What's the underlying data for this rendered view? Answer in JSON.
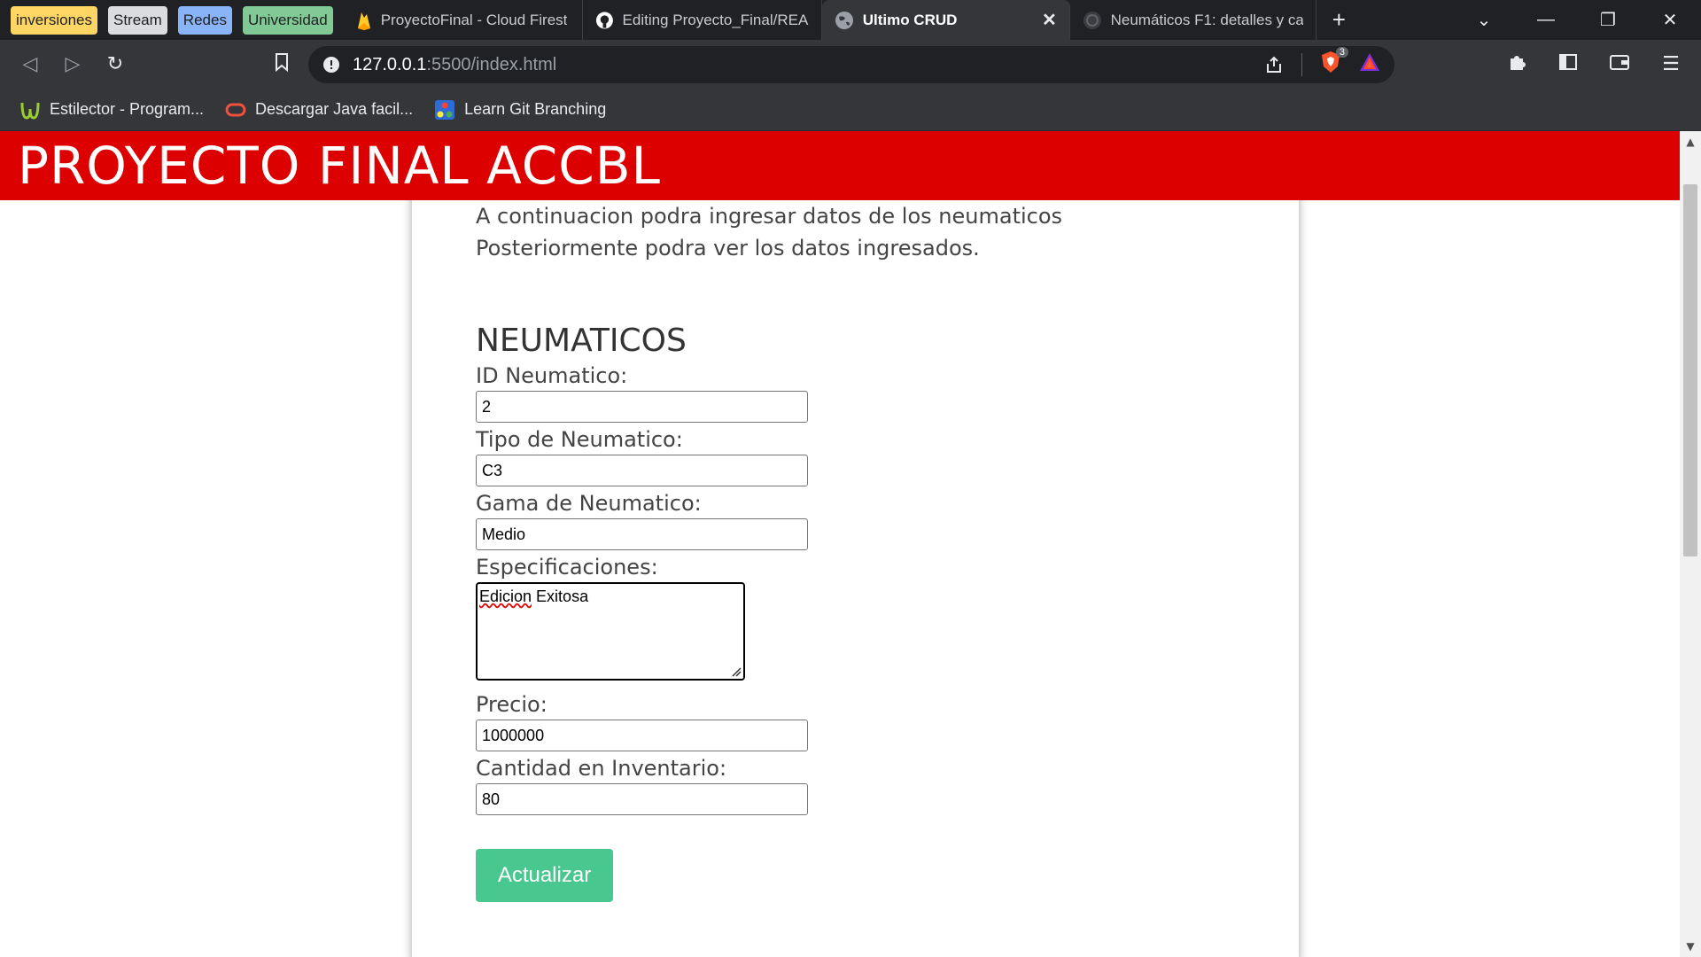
{
  "tab_groups": [
    {
      "label": "inversiones",
      "color": "#fdd663"
    },
    {
      "label": "Stream",
      "color": "#dadce0"
    },
    {
      "label": "Redes",
      "color": "#8ab4f8"
    },
    {
      "label": "Universidad",
      "color": "#81c995"
    }
  ],
  "tabs": [
    {
      "title": "ProyectoFinal - Cloud Firest",
      "icon": "firebase-icon"
    },
    {
      "title": "Editing Proyecto_Final/READ",
      "icon": "github-icon"
    },
    {
      "title": "Ultimo CRUD",
      "icon": "globe-icon",
      "active": true
    },
    {
      "title": "Neumáticos F1: detalles y ca",
      "icon": "f1-icon"
    }
  ],
  "address": {
    "host": "127.0.0.1",
    "path": ":5500/index.html"
  },
  "brave_badge": "3",
  "bookmarks": [
    {
      "label": "Estilector - Program...",
      "icon": "estilector-icon"
    },
    {
      "label": "Descargar Java facil...",
      "icon": "oracle-icon"
    },
    {
      "label": "Learn Git Branching",
      "icon": "git-branching-icon"
    }
  ],
  "page": {
    "banner_title": "PROYECTO FINAL ACCBL",
    "intro_line1": "A continuacion podra ingresar datos de los neumaticos",
    "intro_line2": "Posteriormente podra ver los datos ingresados.",
    "section_title": "NEUMATICOS",
    "fields": {
      "id_label": "ID Neumatico:",
      "id_value": "2",
      "tipo_label": "Tipo de Neumatico:",
      "tipo_value": "C3",
      "gama_label": "Gama de Neumatico:",
      "gama_value": "Medio",
      "espec_label": "Especificaciones:",
      "espec_value_word1": "Edicion",
      "espec_value_word2": " Exitosa",
      "precio_label": "Precio:",
      "precio_value": "1000000",
      "cantidad_label": "Cantidad en Inventario:",
      "cantidad_value": "80"
    },
    "update_button": "Actualizar",
    "colors": {
      "banner": "#dc0000",
      "button": "#48c78e"
    }
  }
}
